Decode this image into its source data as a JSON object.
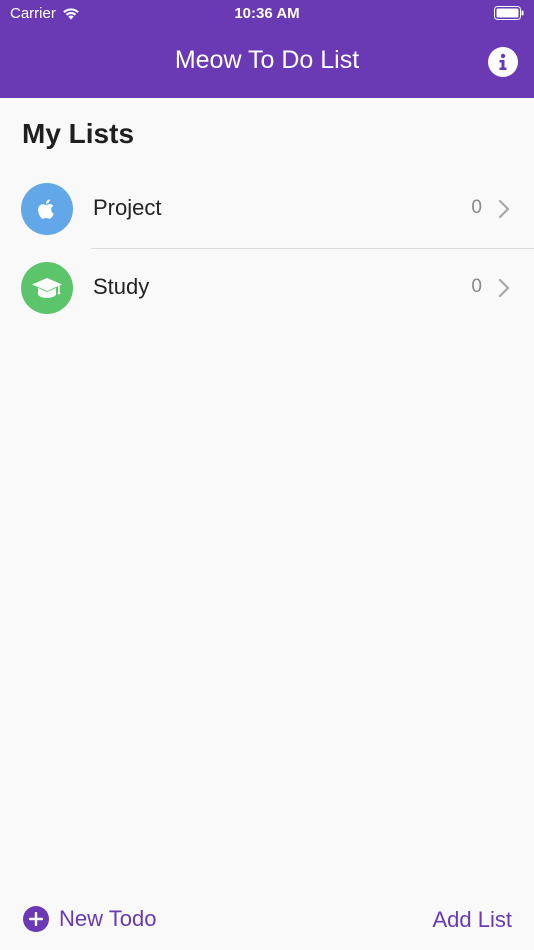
{
  "status_bar": {
    "carrier": "Carrier",
    "time": "10:36 AM"
  },
  "header": {
    "title": "Meow To Do List",
    "info_icon": "info-icon"
  },
  "main": {
    "section_title": "My Lists",
    "lists": [
      {
        "label": "Project",
        "count": "0",
        "icon": "apple-icon",
        "color": "#62a7e8"
      },
      {
        "label": "Study",
        "count": "0",
        "icon": "graduation-cap-icon",
        "color": "#5cc46a"
      }
    ]
  },
  "footer": {
    "new_todo_label": "New Todo",
    "add_list_label": "Add List"
  },
  "colors": {
    "accent": "#6a3ab5",
    "background": "#f9f9f9"
  }
}
